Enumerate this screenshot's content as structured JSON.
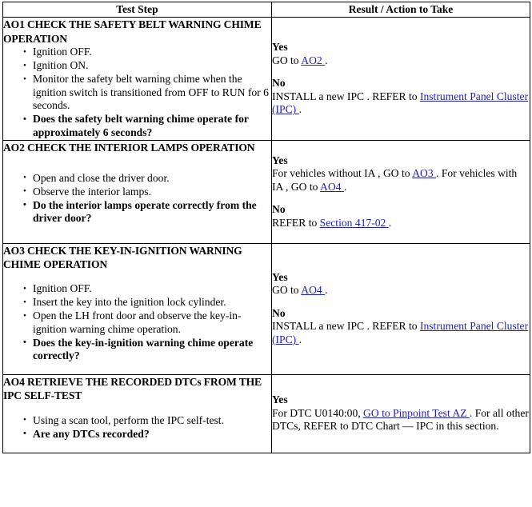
{
  "table": {
    "headers": {
      "left": "Test Step",
      "right": "Result / Action to Take"
    },
    "link_color": "#2222bb",
    "border_color": "#000000"
  },
  "sections": [
    {
      "id": "AO1",
      "title": "AO1 CHECK THE SAFETY BELT WARNING CHIME OPERATION",
      "steps": [
        {
          "text": "Ignition OFF.",
          "bold": false
        },
        {
          "text": "Ignition ON.",
          "bold": false
        },
        {
          "text": "Monitor the safety belt warning chime when the ignition switch is transitioned from OFF to RUN for 6 seconds.",
          "bold": false
        },
        {
          "text": "Does the safety belt warning chime operate for approximately 6 seconds?",
          "bold": true
        }
      ],
      "result": {
        "yes_label": "Yes",
        "yes_parts": [
          {
            "t": "GO to ",
            "link": false
          },
          {
            "t": "AO2 ",
            "link": true
          },
          {
            "t": ".",
            "link": false
          }
        ],
        "no_label": "No",
        "no_parts": [
          {
            "t": "INSTALL a new IPC . REFER to ",
            "link": false
          },
          {
            "t": "Instrument Panel Cluster (IPC) ",
            "link": true
          },
          {
            "t": ".",
            "link": false
          }
        ]
      }
    },
    {
      "id": "AO2",
      "title": "AO2 CHECK THE INTERIOR LAMPS OPERATION",
      "steps": [
        {
          "text": "Open and close the driver door.",
          "bold": false
        },
        {
          "text": "Observe the interior lamps.",
          "bold": false
        },
        {
          "text": "Do the interior lamps operate correctly from the driver door?",
          "bold": true
        }
      ],
      "result": {
        "yes_label": "Yes",
        "yes_parts": [
          {
            "t": "For vehicles without IA , GO to ",
            "link": false
          },
          {
            "t": "AO3 ",
            "link": true
          },
          {
            "t": ". For vehicles with IA , GO to ",
            "link": false
          },
          {
            "t": "AO4 ",
            "link": true
          },
          {
            "t": ".",
            "link": false
          }
        ],
        "no_label": "No",
        "no_parts": [
          {
            "t": "REFER to ",
            "link": false
          },
          {
            "t": "Section 417-02 ",
            "link": true
          },
          {
            "t": ".",
            "link": false
          }
        ]
      }
    },
    {
      "id": "AO3",
      "title": "AO3 CHECK THE KEY-IN-IGNITION WARNING CHIME OPERATION",
      "steps": [
        {
          "text": "Ignition OFF.",
          "bold": false
        },
        {
          "text": "Insert the key into the ignition lock cylinder.",
          "bold": false
        },
        {
          "text": "Open the LH front door and observe the key-in-ignition warning chime operation.",
          "bold": false
        },
        {
          "text": "Does the key-in-ignition warning chime operate correctly?",
          "bold": true
        }
      ],
      "result": {
        "yes_label": "Yes",
        "yes_parts": [
          {
            "t": "GO to ",
            "link": false
          },
          {
            "t": "AO4 ",
            "link": true
          },
          {
            "t": ".",
            "link": false
          }
        ],
        "no_label": "No",
        "no_parts": [
          {
            "t": "INSTALL a new IPC . REFER to ",
            "link": false
          },
          {
            "t": "Instrument Panel Cluster (IPC) ",
            "link": true
          },
          {
            "t": ".",
            "link": false
          }
        ]
      }
    },
    {
      "id": "AO4",
      "title": "AO4 RETRIEVE THE RECORDED DTCs FROM THE IPC SELF-TEST",
      "steps": [
        {
          "text": "Using a scan tool, perform the IPC self-test.",
          "bold": false
        },
        {
          "text": "Are any DTCs recorded?",
          "bold": true
        }
      ],
      "result": {
        "yes_label": "Yes",
        "yes_parts": [
          {
            "t": "For DTC U0140:00, ",
            "link": false
          },
          {
            "t": "GO to Pinpoint Test AZ ",
            "link": true
          },
          {
            "t": ". For all other DTCs, REFER to DTC Chart — IPC in this section.",
            "link": false
          }
        ],
        "no_label": "",
        "no_parts": []
      }
    }
  ]
}
